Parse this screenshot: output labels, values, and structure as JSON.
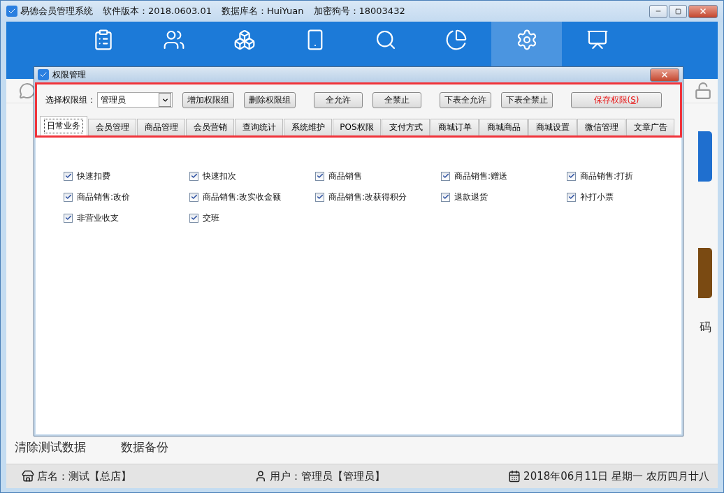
{
  "window": {
    "app_name": "易德会员管理系统",
    "info": [
      "软件版本：2018.0603.01",
      "数据库名：HuiYuan",
      "加密狗号：18003432"
    ]
  },
  "nav": [
    {
      "selected": false
    },
    {
      "selected": false
    },
    {
      "selected": false
    },
    {
      "selected": false
    },
    {
      "selected": false
    },
    {
      "selected": false
    },
    {
      "selected": true
    },
    {
      "selected": false
    }
  ],
  "background": {
    "side_text": "码",
    "links": [
      "清除测试数据",
      "数据备份"
    ]
  },
  "dialog": {
    "title": "权限管理",
    "group_label": "选择权限组：",
    "group_value": "管理员",
    "button_groups": [
      [
        {
          "label": "增加权限组",
          "kind": "normal"
        },
        {
          "label": "删除权限组",
          "kind": "normal"
        }
      ],
      [
        {
          "label": "全允许",
          "kind": "normal"
        },
        {
          "label": "全禁止",
          "kind": "normal"
        }
      ],
      [
        {
          "label": "下表全允许",
          "kind": "normal"
        },
        {
          "label": "下表全禁止",
          "kind": "normal"
        }
      ],
      [
        {
          "label": "保存权限(",
          "shortcut": "S",
          "suffix": ")",
          "kind": "save"
        }
      ]
    ],
    "tabs": [
      {
        "label": "日常业务",
        "selected": true
      },
      {
        "label": "会员管理",
        "selected": false
      },
      {
        "label": "商品管理",
        "selected": false
      },
      {
        "label": "会员营销",
        "selected": false
      },
      {
        "label": "查询统计",
        "selected": false
      },
      {
        "label": "系统维护",
        "selected": false
      },
      {
        "label": "POS权限",
        "selected": false
      },
      {
        "label": "支付方式",
        "selected": false
      },
      {
        "label": "商城订单",
        "selected": false
      },
      {
        "label": "商城商品",
        "selected": false
      },
      {
        "label": "商城设置",
        "selected": false
      },
      {
        "label": "微信管理",
        "selected": false
      },
      {
        "label": "文章广告",
        "selected": false
      }
    ],
    "permissions": [
      {
        "label": "快速扣费",
        "checked": true
      },
      {
        "label": "快速扣次",
        "checked": true
      },
      {
        "label": "商品销售",
        "checked": true
      },
      {
        "label": "商品销售:赠送",
        "checked": true
      },
      {
        "label": "商品销售:打折",
        "checked": true
      },
      {
        "label": "商品销售:改价",
        "checked": true
      },
      {
        "label": "商品销售:改实收金额",
        "checked": true
      },
      {
        "label": "商品销售:改获得积分",
        "checked": true
      },
      {
        "label": "退款退货",
        "checked": true
      },
      {
        "label": "补打小票",
        "checked": true
      },
      {
        "label": "非营业收支",
        "checked": true
      },
      {
        "label": "交班",
        "checked": true
      }
    ]
  },
  "status_bar": {
    "store": "店名：测试【总店】",
    "user": "用户：管理员【管理员】",
    "date": "2018年06月11日 星期一 农历四月廿八"
  }
}
